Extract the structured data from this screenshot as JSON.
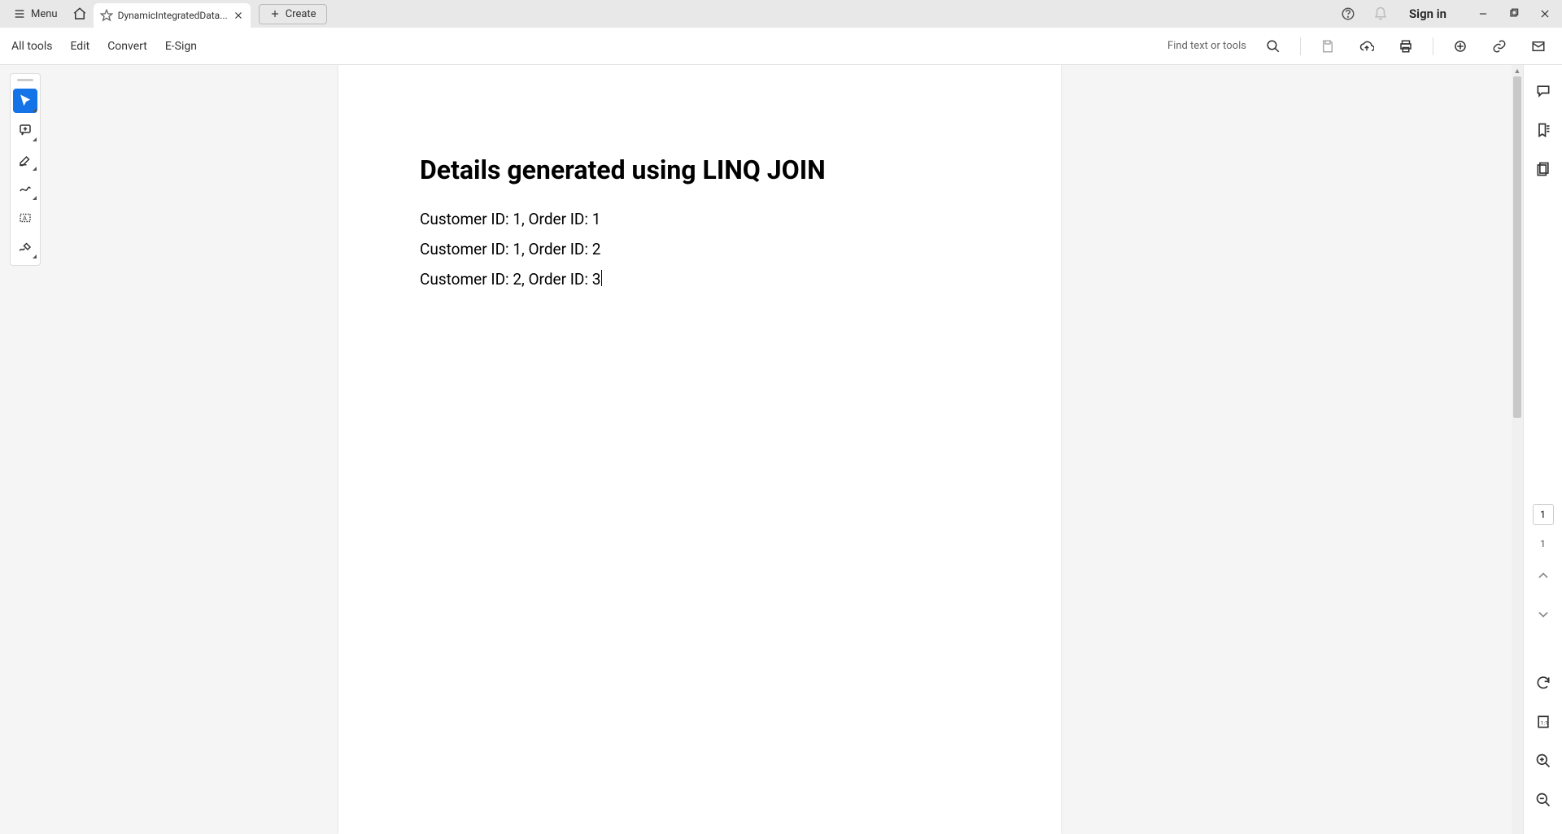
{
  "titlebar": {
    "menu_label": "Menu",
    "tab_title": "DynamicIntegratedData...",
    "create_label": "Create",
    "sign_in_label": "Sign in"
  },
  "toolbar": {
    "all_tools": "All tools",
    "edit": "Edit",
    "convert": "Convert",
    "esign": "E-Sign",
    "find_placeholder": "Find text or tools"
  },
  "document": {
    "heading": "Details generated using LINQ JOIN",
    "lines": [
      "Customer ID: 1, Order ID: 1",
      "Customer ID: 1, Order ID: 2",
      "Customer ID: 2, Order ID: 3"
    ]
  },
  "nav": {
    "current_page": "1",
    "total_pages": "1"
  }
}
